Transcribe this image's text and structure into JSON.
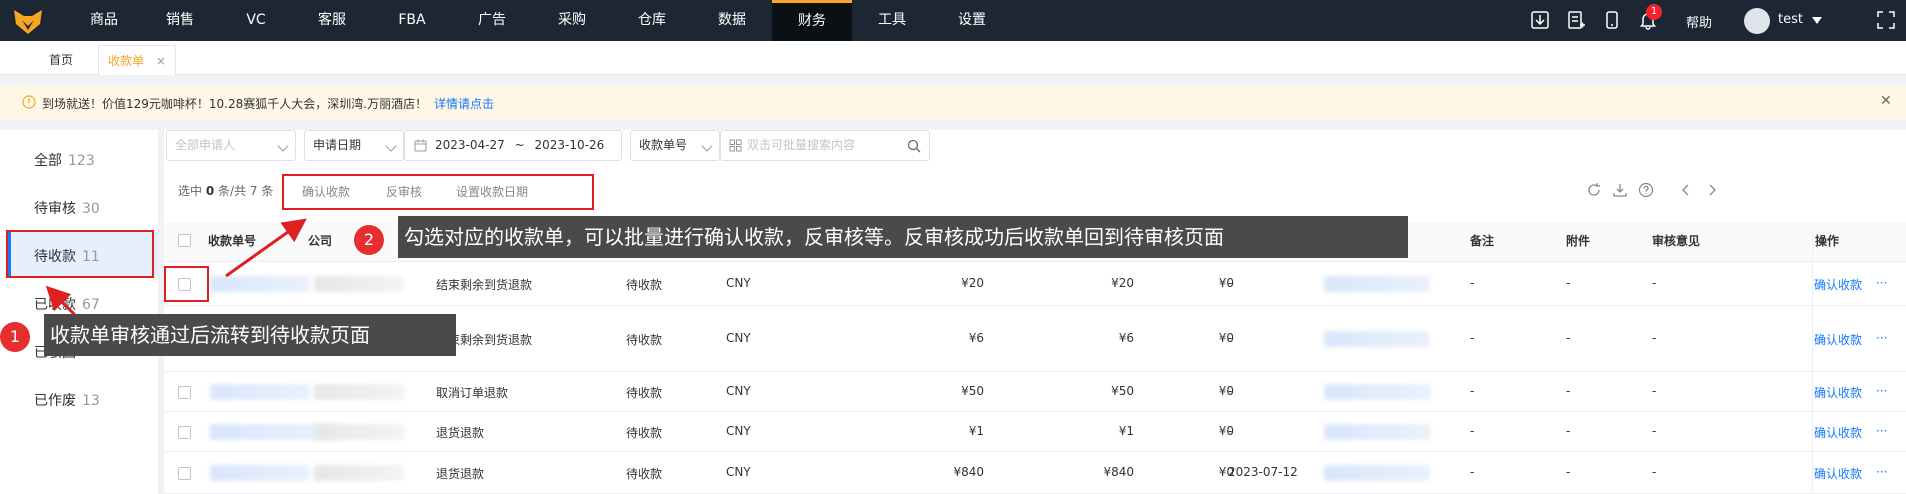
{
  "nav": {
    "items": [
      "商品",
      "销售",
      "VC",
      "客服",
      "FBA",
      "广告",
      "采购",
      "仓库",
      "数据",
      "财务",
      "工具",
      "设置"
    ],
    "active": "财务",
    "help": "帮助",
    "user": "test",
    "notification_count": "1"
  },
  "tabs": {
    "home": "首页",
    "current": "收款单",
    "close": "×"
  },
  "banner": {
    "text": "到场就送！价值129元咖啡杯！10.28赛狐千人大会，深圳湾.万丽酒店！",
    "link": "详情请点击",
    "close": "✕"
  },
  "sidebar": {
    "items": [
      {
        "label": "全部",
        "count": "123"
      },
      {
        "label": "待审核",
        "count": "30"
      },
      {
        "label": "待收款",
        "count": "11"
      },
      {
        "label": "已收款",
        "count": "67"
      },
      {
        "label": "已驳回",
        "count": ""
      },
      {
        "label": "已作废",
        "count": "13"
      }
    ]
  },
  "filters": {
    "applicant": "全部申请人",
    "date_type": "申请日期",
    "date_start": "2023-04-27",
    "date_sep": "~",
    "date_end": "2023-10-26",
    "search_type": "收款单号",
    "search_placeholder": "双击可批量搜索内容"
  },
  "selection": {
    "text_a": "选中",
    "selected": "0",
    "text_b": "条/共",
    "total": "7",
    "text_c": "条"
  },
  "actions": {
    "confirm": "确认收款",
    "reverse": "反审核",
    "set_date": "设置收款日期"
  },
  "table": {
    "headers": {
      "no": "收款单号",
      "company": "公司",
      "remark": "备注",
      "attach": "附件",
      "opinion": "审核意见",
      "op": "操作"
    },
    "rows": [
      {
        "type": "结束剩余到货退款",
        "status": "待收款",
        "currency": "CNY",
        "a": "¥20",
        "b": "¥20",
        "c": "¥0",
        "date": "-",
        "remark": "-",
        "attach": "-",
        "opinion": "-",
        "op": "确认收款",
        "more": "···"
      },
      {
        "type": "结束剩余到货退款",
        "status": "待收款",
        "currency": "CNY",
        "a": "¥6",
        "b": "¥6",
        "c": "¥0",
        "date": "-",
        "remark": "-",
        "attach": "-",
        "opinion": "-",
        "op": "确认收款",
        "more": "···"
      },
      {
        "type": "取消订单退款",
        "status": "待收款",
        "currency": "CNY",
        "a": "¥50",
        "b": "¥50",
        "c": "¥0",
        "date": "-",
        "remark": "-",
        "attach": "-",
        "opinion": "-",
        "op": "确认收款",
        "more": "···"
      },
      {
        "type": "退货退款",
        "status": "待收款",
        "currency": "CNY",
        "a": "¥1",
        "b": "¥1",
        "c": "¥0",
        "date": "-",
        "remark": "-",
        "attach": "-",
        "opinion": "-",
        "op": "确认收款",
        "more": "···"
      },
      {
        "type": "退货退款",
        "status": "待收款",
        "currency": "CNY",
        "a": "¥840",
        "b": "¥840",
        "c": "¥0",
        "date": "2023-07-12",
        "remark": "-",
        "attach": "-",
        "opinion": "-",
        "op": "确认收款",
        "more": "···"
      }
    ]
  },
  "annotations": {
    "tip1_num": "1",
    "tip1": "收款单审核通过后流转到待收款页面",
    "tip2_num": "2",
    "tip2": "勾选对应的收款单，可以批量进行确认收款，反审核等。反审核成功后收款单回到待审核页面"
  },
  "colors": {
    "nav_bg": "#1d2733",
    "accent": "#f5a623",
    "link": "#1677ff",
    "annotation_red": "#e02020"
  }
}
